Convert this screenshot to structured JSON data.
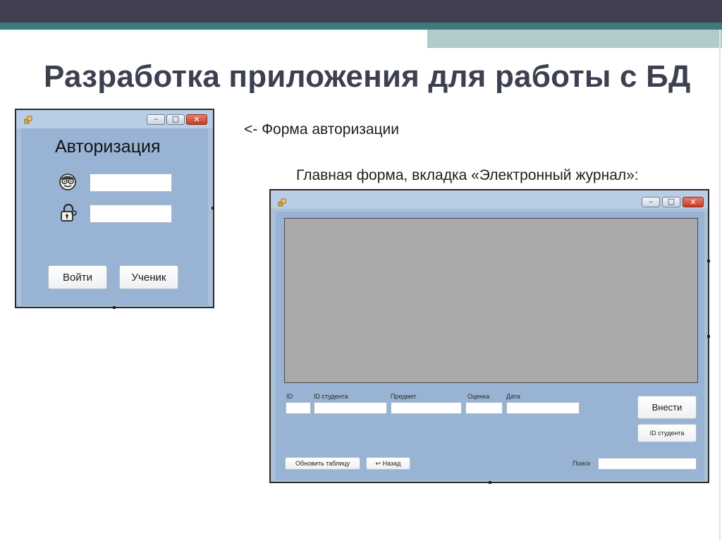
{
  "slide": {
    "title": "Разработка приложения для работы с БД",
    "caption_login": "<- Форма авторизации",
    "caption_main": "Главная форма, вкладка «Электронный журнал»:"
  },
  "login_form": {
    "heading": "Авторизация",
    "login_icon": "face-with-glasses-icon",
    "password_icon": "lock-icon",
    "login_value": "",
    "password_value": "",
    "enter_button": "Войти",
    "student_button": "Ученик"
  },
  "main_form": {
    "fields": {
      "id_label": "ID",
      "student_id_label": "ID студента",
      "subject_label": "Предмет",
      "grade_label": "Оценка",
      "date_label": "Дата"
    },
    "submit_button": "Внести",
    "student_id_button": "ID студента",
    "refresh_button": "Обновить таблицу",
    "back_button": "↩ Назад",
    "search_label": "Поиск",
    "search_value": ""
  },
  "window_controls": {
    "minimize": "–",
    "maximize": "□",
    "close": "✕"
  },
  "colors": {
    "top_band": "#404052",
    "teal": "#3d7a7c",
    "light_teal": "#b0cbca",
    "form_client": "#98b3d3",
    "grid_area": "#a9a9a9"
  }
}
